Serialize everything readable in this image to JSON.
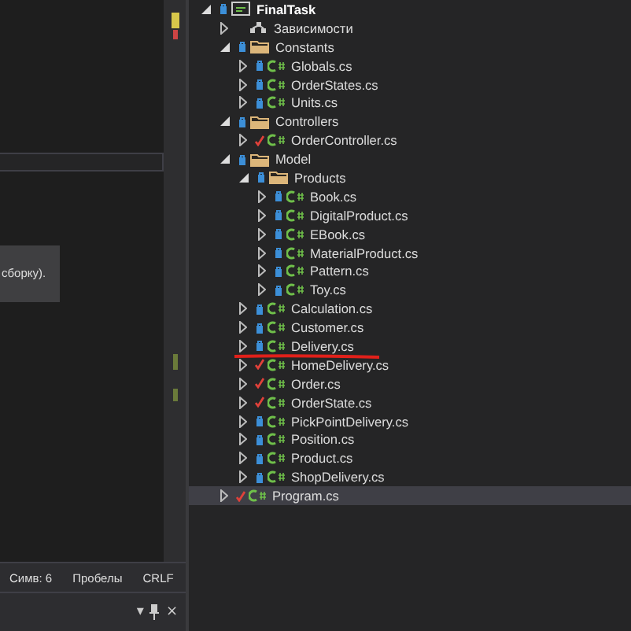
{
  "editor": {
    "tooltip": "сборку)."
  },
  "status_bar": {
    "items": [
      "Симв: 6",
      "Пробелы",
      "CRLF"
    ]
  },
  "tool_panel": {
    "buttons": [
      "▾",
      "×"
    ]
  },
  "tree": [
    {
      "label": "FinalTask",
      "kind": "project",
      "checked_out": false,
      "expanded": true,
      "selected": false,
      "underlined": false,
      "children": [
        {
          "label": "Зависимости",
          "kind": "dependencies",
          "expanded": false,
          "selected": false,
          "underlined": false
        },
        {
          "label": "Constants",
          "kind": "folder",
          "checked_out": false,
          "expanded": true,
          "selected": false,
          "underlined": false,
          "children": [
            {
              "label": "Globals.cs",
              "kind": "file",
              "checked_out": false,
              "expanded": false,
              "selected": false,
              "underlined": false
            },
            {
              "label": "OrderStates.cs",
              "kind": "file",
              "checked_out": false,
              "expanded": false,
              "selected": false,
              "underlined": false
            },
            {
              "label": "Units.cs",
              "kind": "file",
              "checked_out": false,
              "expanded": false,
              "selected": false,
              "underlined": false
            }
          ]
        },
        {
          "label": "Controllers",
          "kind": "folder",
          "checked_out": false,
          "expanded": true,
          "selected": false,
          "underlined": false,
          "children": [
            {
              "label": "OrderController.cs",
              "kind": "file",
              "checked_out": true,
              "expanded": false,
              "selected": false,
              "underlined": false
            }
          ]
        },
        {
          "label": "Model",
          "kind": "folder",
          "checked_out": false,
          "expanded": true,
          "selected": false,
          "underlined": false,
          "children": [
            {
              "label": "Products",
              "kind": "folder",
              "checked_out": false,
              "expanded": true,
              "selected": false,
              "underlined": false,
              "children": [
                {
                  "label": "Book.cs",
                  "kind": "file",
                  "checked_out": false,
                  "expanded": false,
                  "selected": false,
                  "underlined": false
                },
                {
                  "label": "DigitalProduct.cs",
                  "kind": "file",
                  "checked_out": false,
                  "expanded": false,
                  "selected": false,
                  "underlined": false
                },
                {
                  "label": "EBook.cs",
                  "kind": "file",
                  "checked_out": false,
                  "expanded": false,
                  "selected": false,
                  "underlined": false
                },
                {
                  "label": "MaterialProduct.cs",
                  "kind": "file",
                  "checked_out": false,
                  "expanded": false,
                  "selected": false,
                  "underlined": false
                },
                {
                  "label": "Pattern.cs",
                  "kind": "file",
                  "checked_out": false,
                  "expanded": false,
                  "selected": false,
                  "underlined": false
                },
                {
                  "label": "Toy.cs",
                  "kind": "file",
                  "checked_out": false,
                  "expanded": false,
                  "selected": false,
                  "underlined": false
                }
              ]
            },
            {
              "label": "Calculation.cs",
              "kind": "file",
              "checked_out": false,
              "expanded": false,
              "selected": false,
              "underlined": false
            },
            {
              "label": "Customer.cs",
              "kind": "file",
              "checked_out": false,
              "expanded": false,
              "selected": false,
              "underlined": false
            },
            {
              "label": "Delivery.cs",
              "kind": "file",
              "checked_out": false,
              "expanded": false,
              "selected": false,
              "underlined": true
            },
            {
              "label": "HomeDelivery.cs",
              "kind": "file",
              "checked_out": true,
              "expanded": false,
              "selected": false,
              "underlined": false
            },
            {
              "label": "Order.cs",
              "kind": "file",
              "checked_out": true,
              "expanded": false,
              "selected": false,
              "underlined": false
            },
            {
              "label": "OrderState.cs",
              "kind": "file",
              "checked_out": true,
              "expanded": false,
              "selected": false,
              "underlined": false
            },
            {
              "label": "PickPointDelivery.cs",
              "kind": "file",
              "checked_out": false,
              "expanded": false,
              "selected": false,
              "underlined": false
            },
            {
              "label": "Position.cs",
              "kind": "file",
              "checked_out": false,
              "expanded": false,
              "selected": false,
              "underlined": false
            },
            {
              "label": "Product.cs",
              "kind": "file",
              "checked_out": false,
              "expanded": false,
              "selected": false,
              "underlined": false
            },
            {
              "label": "ShopDelivery.cs",
              "kind": "file",
              "checked_out": false,
              "expanded": false,
              "selected": false,
              "underlined": false
            }
          ]
        },
        {
          "label": "Program.cs",
          "kind": "file",
          "checked_out": true,
          "expanded": false,
          "selected": true,
          "underlined": false
        }
      ]
    }
  ]
}
